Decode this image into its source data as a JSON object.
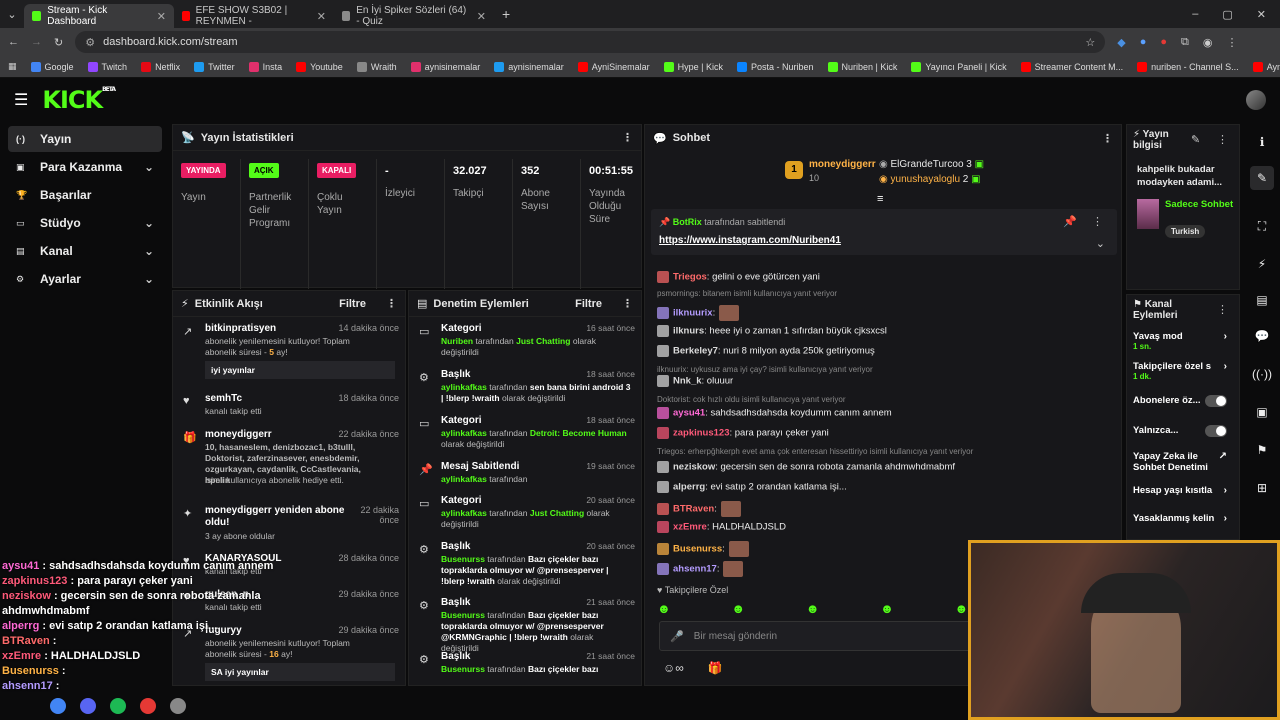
{
  "browser": {
    "tabs": [
      {
        "title": "Stream - Kick Dashboard",
        "active": true,
        "favicon_color": "#53fc18"
      },
      {
        "title": "EFE SHOW S3B02 | REYNMEN -",
        "active": false,
        "favicon_color": "#ff0000"
      },
      {
        "title": "En İyi Spiker Sözleri (64) - Quiz",
        "active": false,
        "favicon_color": "#8a8a8a"
      }
    ],
    "url": "dashboard.kick.com/stream",
    "bookmarks": [
      {
        "label": "Google",
        "color": "#4285f4"
      },
      {
        "label": "Twitch",
        "color": "#9146ff"
      },
      {
        "label": "Netflix",
        "color": "#e50914"
      },
      {
        "label": "Twitter",
        "color": "#1d9bf0"
      },
      {
        "label": "Insta",
        "color": "#e1306c"
      },
      {
        "label": "Youtube",
        "color": "#ff0000"
      },
      {
        "label": "Wraith",
        "color": "#888888"
      },
      {
        "label": "aynisinemalar",
        "color": "#e1306c"
      },
      {
        "label": "aynisinemalar",
        "color": "#1d9bf0"
      },
      {
        "label": "AyniSinemalar",
        "color": "#ff0000"
      },
      {
        "label": "Hype | Kick",
        "color": "#53fc18"
      },
      {
        "label": "Posta - Nuriben",
        "color": "#0a84ff"
      },
      {
        "label": "Nuriben | Kick",
        "color": "#53fc18"
      },
      {
        "label": "Yayıncı Paneli | Kick",
        "color": "#53fc18"
      },
      {
        "label": "Streamer Content M...",
        "color": "#ff0000"
      },
      {
        "label": "nuriben - Channel S...",
        "color": "#ff0000"
      },
      {
        "label": "Aynı Sinemalar - Ça...",
        "color": "#ff0000"
      }
    ]
  },
  "logo": "KICK",
  "logo_sup": "BETA",
  "sidebar": {
    "items": [
      {
        "label": "Yayın",
        "icon": "broadcast-icon",
        "chevron": false
      },
      {
        "label": "Para Kazanma",
        "icon": "money-icon",
        "chevron": true
      },
      {
        "label": "Başarılar",
        "icon": "trophy-icon",
        "chevron": false
      },
      {
        "label": "Stüdyo",
        "icon": "studio-icon",
        "chevron": true
      },
      {
        "label": "Kanal",
        "icon": "channel-icon",
        "chevron": true
      },
      {
        "label": "Ayarlar",
        "icon": "gear-icon",
        "chevron": true
      }
    ]
  },
  "stats": {
    "title": "Yayın İstatistikleri",
    "cols": [
      {
        "badge": "YAYINDA",
        "badge_color": "#e91e63",
        "label": "Yayın"
      },
      {
        "badge": "AÇIK",
        "badge_color": "#53fc18",
        "label": "Partnerlik Gelir Programı"
      },
      {
        "badge": "KAPALI",
        "badge_color": "#e91e63",
        "label": "Çoklu Yayın"
      },
      {
        "value": "-",
        "label": "İzleyici"
      },
      {
        "value": "32.027",
        "label": "Takipçi"
      },
      {
        "value": "352",
        "label": "Abone Sayısı"
      },
      {
        "value": "00:51:55",
        "label": "Yayında Olduğu Süre"
      }
    ]
  },
  "activity": {
    "title": "Etkinlik Akışı",
    "filter": "Filtre",
    "events": [
      {
        "name": "bitkinpratisyen",
        "time": "14 dakika önce",
        "desc": "abonelik yenilemesini kutluyor! Toplam abonelik süresi - ",
        "hl": "5",
        "desc2": " ay!",
        "box": "iyi yayınlar"
      },
      {
        "name": "semhTc",
        "time": "18 dakika önce",
        "desc": "kanalı takip etti"
      },
      {
        "name": "moneydiggerr",
        "time": "22 dakika önce",
        "gift": "10, hasaneslem, denizbozac1, b3tulll, Doktorist, zaferzinasever, enesbdemir, ozgurkayan, caydanlik, CcCastlevania, hpelin",
        "desc": "isimli kullanıcıya abonelik hediye etti."
      },
      {
        "name": "moneydiggerr yeniden abone oldu!",
        "time": "22 dakika önce",
        "desc": "3 ay abone oldular"
      },
      {
        "name": "KANARYASOUL",
        "time": "28 dakika önce",
        "desc": "kanalı takip etti"
      },
      {
        "name": "gulsen_n",
        "time": "29 dakika önce",
        "desc": "kanalı takip etti"
      },
      {
        "name": "fuguryy",
        "time": "29 dakika önce",
        "desc": "abonelik yenilemesini kutluyor! Toplam abonelik süresi - ",
        "hl": "16",
        "desc2": " ay!",
        "box": "SA iyi yayınlar"
      }
    ]
  },
  "moderation": {
    "title": "Denetim Eylemleri",
    "filter": "Filtre",
    "items": [
      {
        "name": "Kategori",
        "time": "16 saat önce",
        "user": "Nuriben",
        "mid": " tarafından ",
        "val": "Just Chatting",
        "end": " olarak değiştirildi"
      },
      {
        "name": "Başlık",
        "time": "18 saat önce",
        "user": "aylinkafkas",
        "mid": " tarafından ",
        "val": "sen bana birini android 3 | !blerp !wraith",
        "end": " olarak değiştirildi"
      },
      {
        "name": "Kategori",
        "time": "18 saat önce",
        "user": "aylinkafkas",
        "mid": " tarafından ",
        "val": "Detroit: Become Human",
        "end": " olarak değiştirildi"
      },
      {
        "name": "Mesaj Sabitlendi",
        "time": "19 saat önce",
        "user": "aylinkafkas",
        "mid": " tarafından",
        "val": "",
        "end": ""
      },
      {
        "name": "Kategori",
        "time": "20 saat önce",
        "user": "aylinkafkas",
        "mid": " tarafından ",
        "val": "Just Chatting",
        "end": " olarak değiştirildi"
      },
      {
        "name": "Başlık",
        "time": "20 saat önce",
        "user": "Busenurss",
        "mid": " tarafından ",
        "val": "Bazı çiçekler bazı topraklarda olmuyor w/ @prensesperver | !blerp !wraith",
        "end": " olarak değiştirildi"
      },
      {
        "name": "Başlık",
        "time": "21 saat önce",
        "user": "Busenurss",
        "mid": " tarafından ",
        "val": "Bazı çiçekler bazı topraklarda olmuyor w/ @prensesperver @KRMNGraphic | !blerp !wraith",
        "end": " olarak değiştirildi"
      },
      {
        "name": "Başlık",
        "time": "21 saat önce",
        "user": "Busenurss",
        "mid": " tarafından ",
        "val": "Bazı çiçekler bazı",
        "end": ""
      }
    ]
  },
  "chat": {
    "title": "Sohbet",
    "top_gifter": {
      "name": "moneydiggerr",
      "rank": "1",
      "count": "10"
    },
    "gifters": [
      {
        "name": "ElGrandeTurcoo",
        "count": "3"
      },
      {
        "name": "yunushayaloglu",
        "count": "2"
      }
    ],
    "pinned": {
      "user": "BotRix",
      "suffix": " tarafından sabitlendi",
      "link": "https://www.instagram.com/Nuriben41"
    },
    "messages": [
      {
        "type": "msg",
        "user": "Triegos",
        "color": "#ff6b6b",
        "text": ": gelini o eve götürcen yani"
      },
      {
        "type": "reply",
        "text": "psmornings: bitanem   isimli kullanıcıya yanıt veriyor"
      },
      {
        "type": "msg",
        "user": "ilknuurix",
        "color": "#b49cff",
        "text": ":"
      },
      {
        "type": "msg",
        "user": "ilknurs",
        "color": "#dddddd",
        "text": ": heee iyi o zaman 1 sıfırdan büyük cjksxcsl"
      },
      {
        "type": "msg",
        "user": "Berkeley7",
        "color": "#dddddd",
        "text": ": nuri 8 milyon ayda 250k getiriyomuş"
      },
      {
        "type": "reply",
        "text": "ilknuurix: uykusuz ama iyi çay? isimli kullanıcıya yanıt veriyor"
      },
      {
        "type": "msg",
        "user": "Nnk_k",
        "color": "#dddddd",
        "text": ": oluuur"
      },
      {
        "type": "reply",
        "text": "Doktorist: cok hızlı oldu isimli kullanıcıya yanıt veriyor"
      },
      {
        "type": "msg",
        "user": "aysu41",
        "color": "#ff6ad5",
        "text": ": sahdsadhsdahsda koydumm canım annem"
      },
      {
        "type": "msg",
        "user": "zapkinus123",
        "color": "#ff5a7a",
        "text": ": para parayı çeker yani"
      },
      {
        "type": "reply",
        "text": "Triegos: erherpğhkerph evet ama çok enteresan hissettiriyo isimli kullanıcıya yanıt veriyor"
      },
      {
        "type": "msg",
        "user": "neziskow",
        "color": "#dddddd",
        "text": ": gecersin sen de sonra robota zamanla ahdmwhdmabmf"
      },
      {
        "type": "msg",
        "user": "alperrg",
        "color": "#dddddd",
        "text": ": evi satıp 2 orandan katlama işi..."
      },
      {
        "type": "msg",
        "user": "BTRaven",
        "color": "#ff6b6b",
        "text": ":"
      },
      {
        "type": "msg",
        "user": "xzEmre",
        "color": "#ff5a7a",
        "text": ": HALDHALDJSLD"
      },
      {
        "type": "msg",
        "user": "Busenurss",
        "color": "#ffb347",
        "text": ":"
      },
      {
        "type": "msg",
        "user": "ahsenn17",
        "color": "#b49cff",
        "text": ":"
      }
    ],
    "followers_only": "Takipçilere Özel",
    "input_placeholder": "Bir mesaj gönderin"
  },
  "stream_info": {
    "title": "Yayın bilgisi",
    "stream_title": "kahpelik bukadar modayken adami...",
    "category": "Sadece Sohbet",
    "language": "Turkish"
  },
  "channel_actions": {
    "title": "Kanal Eylemleri",
    "items": [
      {
        "label": "Yavaş mod",
        "sub": "1 sn.",
        "ctl": "chevron"
      },
      {
        "label": "Takipçilere özel s",
        "sub": "1 dk.",
        "ctl": "chevron"
      },
      {
        "label": "Abonelere öz...",
        "sub": "",
        "ctl": "toggle"
      },
      {
        "label": "Yalnızca...",
        "sub": "",
        "ctl": "toggle"
      },
      {
        "label": "Yapay Zeka ile Sohbet Denetimi",
        "sub": "",
        "ctl": "external"
      },
      {
        "label": "Hesap yaşı kısıtla",
        "sub": "",
        "ctl": "chevron"
      },
      {
        "label": "Yasaklanmış kelin",
        "sub": "",
        "ctl": "chevron"
      }
    ]
  },
  "overlay_chat": [
    {
      "user": "aysu41",
      "color": "#ff6ad5",
      "text": " : sahdsadhsdahsda koydumm canım annem"
    },
    {
      "user": "zapkinus123",
      "color": "#ff5a7a",
      "text": " : para parayı çeker yani"
    },
    {
      "user": "neziskow",
      "color": "#ff5a7a",
      "text": " : gecersin sen de sonra robota zamanla"
    },
    {
      "user": "",
      "color": "#ffffff",
      "text": "ahdmwhdmabmf"
    },
    {
      "user": "alperrg",
      "color": "#ff6ad5",
      "text": " : evi satıp 2 orandan katlama işi..."
    },
    {
      "user": "BTRaven",
      "color": "#ff6b6b",
      "text": " :"
    },
    {
      "user": "xzEmre",
      "color": "#ff5a7a",
      "text": " : HALDHALDJSLD"
    },
    {
      "user": "Busenurss",
      "color": "#ffb347",
      "text": " :"
    },
    {
      "user": "ahsenn17",
      "color": "#b49cff",
      "text": " :"
    }
  ]
}
